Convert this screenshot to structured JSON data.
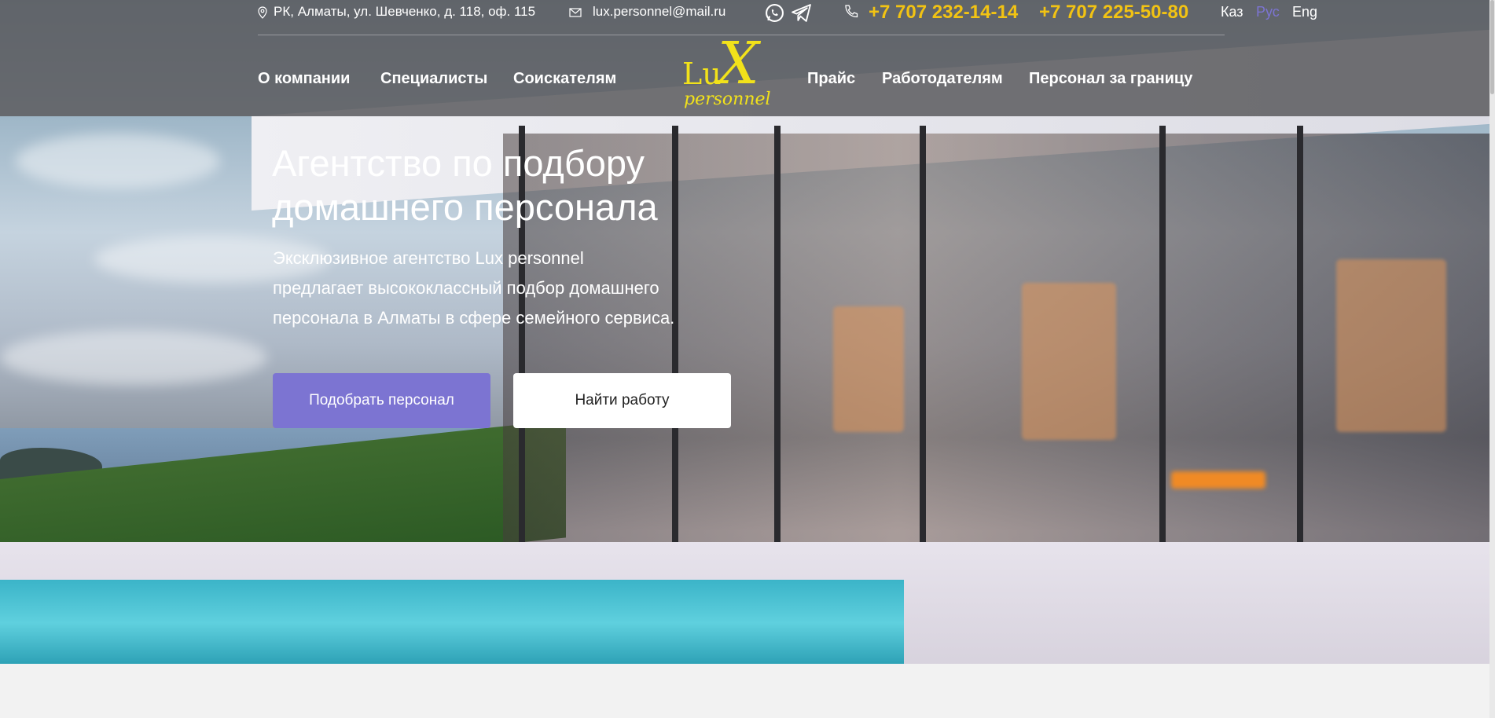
{
  "topbar": {
    "address": "РК, Алматы, ул. Шевченко, д. 118, оф. 115",
    "email": "lux.personnel@mail.ru",
    "phone1": "+7 707 232-14-14",
    "phone2": "+7 707 225-50-80",
    "languages": [
      "Каз",
      "Рус",
      "Eng"
    ],
    "active_language": "Рус"
  },
  "nav": {
    "left": [
      "О компании",
      "Специалисты",
      "Соискателям"
    ],
    "right": [
      "Прайс",
      "Работодателям",
      "Персонал за границу"
    ]
  },
  "logo": {
    "text_lu": "Lu",
    "text_x": "X",
    "text_personnel": "personnel"
  },
  "hero": {
    "title_line1": "Агентство по подбору",
    "title_line2": "домашнего персонала",
    "lead_line1": "Эксклюзивное агентство Lux personnel",
    "lead_line2": "предлагает высококлассный подбор домашнего",
    "lead_line3": "персонала в Алматы в сфере семейного сервиса.",
    "primary_button": "Подобрать персонал",
    "secondary_button": "Найти работу"
  },
  "colors": {
    "accent": "#7c74d2",
    "phone": "#f2c313",
    "logo": "#f2e21a",
    "topbar_bg": "#5f5f62"
  },
  "icons": [
    "location-pin-icon",
    "mail-icon",
    "whatsapp-icon",
    "telegram-icon",
    "phone-icon"
  ]
}
